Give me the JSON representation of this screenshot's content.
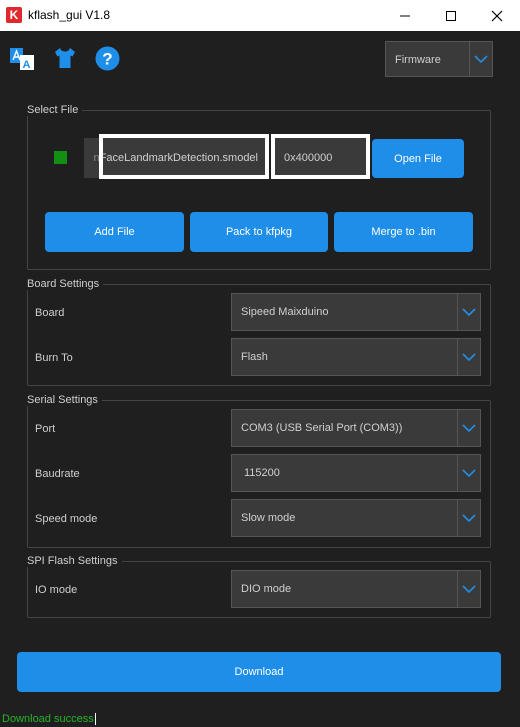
{
  "window": {
    "logo": "K",
    "title": "kflash_gui V1.8"
  },
  "toolbar": {
    "icons": [
      "translate-icon",
      "tshirt-icon",
      "help-icon"
    ],
    "mode_select": "Firmware"
  },
  "select_file": {
    "group_title": "Select File",
    "file_path": "FaceLandmarkDetection.smodel",
    "file_path_partial": "n",
    "address": "0x400000",
    "open_file_label": "Open File",
    "add_file_label": "Add File",
    "pack_label": "Pack to kfpkg",
    "merge_label": "Merge to .bin",
    "status_color": "#138f13"
  },
  "board_settings": {
    "group_title": "Board Settings",
    "board_label": "Board",
    "board_value": "Sipeed Maixduino",
    "burn_to_label": "Burn To",
    "burn_to_value": "Flash"
  },
  "serial_settings": {
    "group_title": "Serial Settings",
    "port_label": "Port",
    "port_value": "COM3 (USB Serial Port (COM3))",
    "baud_label": "Baudrate",
    "baud_value": "115200",
    "speed_label": "Speed mode",
    "speed_value": "Slow mode"
  },
  "spi_settings": {
    "group_title": "SPI Flash Settings",
    "io_label": "IO mode",
    "io_value": "DIO mode"
  },
  "download_label": "Download",
  "status_text": "Download success",
  "colors": {
    "accent": "#1f8ee8",
    "background": "#1f1f1f",
    "status_green": "#28b428"
  }
}
